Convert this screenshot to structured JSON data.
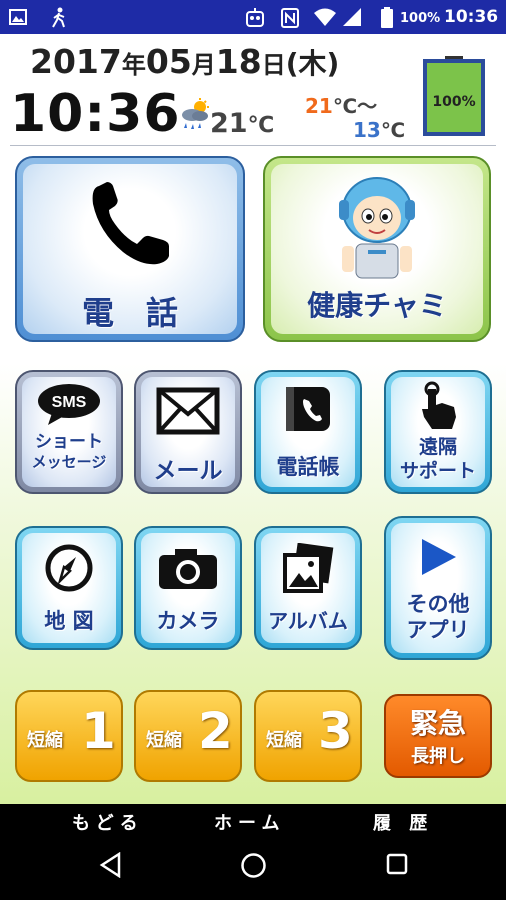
{
  "status_bar": {
    "battery_percent": "100%",
    "clock": "10:36",
    "icons": [
      "image-icon",
      "walking-person-icon",
      "robot-face-icon",
      "nfc-icon",
      "wifi-icon",
      "cell-signal-icon",
      "battery-icon"
    ]
  },
  "header": {
    "date": {
      "year": "2017",
      "year_unit": "年",
      "month": "05",
      "month_unit": "月",
      "day": "18",
      "day_unit": "日",
      "weekday": "(木)"
    },
    "time": "10:36",
    "weather": {
      "icon": "cloudy-sun-rain-icon",
      "current": "21",
      "unit": "℃"
    },
    "high_temp": "21",
    "high_unit": "℃～",
    "low_temp": "13",
    "low_unit": "℃",
    "battery_widget": "100%"
  },
  "tiles": {
    "phone": {
      "label": "電　話",
      "icon": "phone-handset-icon"
    },
    "health": {
      "label": "健康チャミ",
      "icon": "robot-character-icon"
    },
    "sms": {
      "badge": "SMS",
      "line1": "ショート",
      "line2": "メッセージ",
      "icon": "sms-bubble-icon"
    },
    "mail": {
      "label": "メール",
      "icon": "envelope-icon"
    },
    "phonebook": {
      "label": "電話帳",
      "icon": "phonebook-icon"
    },
    "remote": {
      "line1": "遠隔",
      "line2": "サポート",
      "icon": "touch-hand-icon"
    },
    "map": {
      "label": "地 図",
      "icon": "compass-icon"
    },
    "camera": {
      "label": "カメラ",
      "icon": "camera-icon"
    },
    "album": {
      "label": "アルバム",
      "icon": "photos-icon"
    },
    "other_apps": {
      "line1": "その他",
      "line2": "アプリ",
      "icon": "play-triangle-icon"
    }
  },
  "shortcuts": [
    {
      "prefix": "短縮",
      "number": "1"
    },
    {
      "prefix": "短縮",
      "number": "2"
    },
    {
      "prefix": "短縮",
      "number": "3"
    }
  ],
  "emergency": {
    "line1": "緊急",
    "line2": "長押し"
  },
  "soft_nav": {
    "back": "もどる",
    "home": "ホーム",
    "history": "履 歴"
  },
  "colors": {
    "status_bar": "#1e2ba6",
    "tile_blue": "#4f8fd4",
    "tile_green": "#8cc44a",
    "tile_cyan": "#2fa6d6",
    "shortcut_orange": "#f0a300",
    "emergency_red": "#e35a00",
    "label_blue": "#1f3e8c",
    "high_temp": "#f06a1c",
    "low_temp": "#3a72c9",
    "battery_green": "#7cc34a"
  }
}
